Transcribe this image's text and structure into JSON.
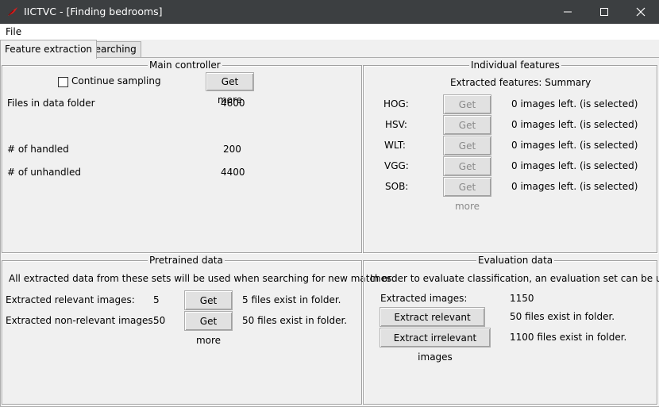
{
  "window": {
    "title": "IICTVC - [Finding bedrooms]"
  },
  "menu": {
    "file": "File"
  },
  "tabs": [
    {
      "label": "Feature extraction"
    },
    {
      "label": "Searching"
    }
  ],
  "main_controller": {
    "legend": "Main controller",
    "continue_sampling": "Continue sampling",
    "continue_sampling_checked": false,
    "get_more": "Get more",
    "files_label": "Files in data folder",
    "files_value": "4600",
    "handled_label": "# of handled",
    "handled_value": "200",
    "unhandled_label": "# of unhandled",
    "unhandled_value": "4400"
  },
  "individual_features": {
    "legend": "Individual features",
    "summary": "Extracted features: Summary",
    "rows": [
      {
        "name": "HOG:",
        "button": "Get more",
        "status": "0 images left. (is selected)"
      },
      {
        "name": "HSV:",
        "button": "Get more",
        "status": "0 images left. (is selected)"
      },
      {
        "name": "WLT:",
        "button": "Get more",
        "status": "0 images left. (is selected)"
      },
      {
        "name": "VGG:",
        "button": "Get more",
        "status": "0 images left. (is selected)"
      },
      {
        "name": "SOB:",
        "button": "Get more",
        "status": "0 images left. (is selected)"
      }
    ]
  },
  "pretrained": {
    "legend": "Pretrained data",
    "description": "All extracted data from these sets will be used when searching for new matches.",
    "rows": [
      {
        "label": "Extracted relevant images:",
        "value": "5",
        "button": "Get more",
        "info": "5 files exist in folder."
      },
      {
        "label": "Extracted non-relevant images:",
        "value": "50",
        "button": "Get more",
        "info": "50 files exist in folder."
      }
    ]
  },
  "evaluation": {
    "legend": "Evaluation data",
    "description": "In order to evaluate classification, an evaluation set can be used.",
    "extracted_label": "Extracted images:",
    "extracted_value": "1150",
    "relevant_button": "Extract relevant images",
    "relevant_info": "50 files exist in folder.",
    "irrelevant_button": "Extract irrelevant images",
    "irrelevant_info": "1100 files exist in folder."
  }
}
